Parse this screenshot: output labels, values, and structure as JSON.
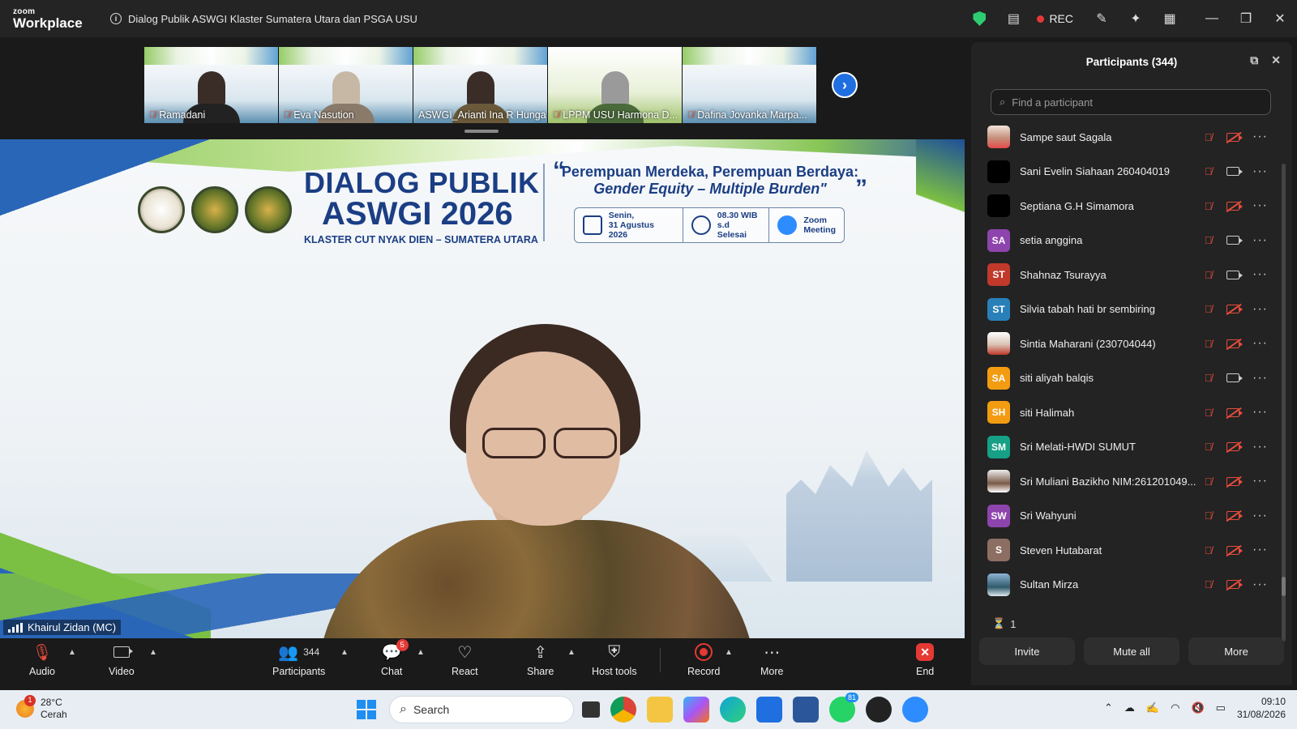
{
  "app": {
    "logo_small": "zoom",
    "logo_big": "Workplace",
    "meeting_title": "Dialog Publik ASWGI Klaster Sumatera Utara dan PSGA USU",
    "rec_label": "REC"
  },
  "strip": {
    "thumbnails": [
      {
        "name": "Ramadani"
      },
      {
        "name": "Eva Nasution"
      },
      {
        "name": "ASWGI_Arianti Ina R Hunga"
      },
      {
        "name": "LPPM USU Harmona D..."
      },
      {
        "name": "Dafina Jovanka Marpa..."
      }
    ]
  },
  "slide": {
    "title_line1": "DIALOG PUBLIK",
    "title_line2": "ASWGI 2026",
    "subtitle": "KLASTER CUT NYAK DIEN – SUMATERA UTARA",
    "quote_line1": "Perempuan Merdeka, Perempuan Berdaya:",
    "quote_line2": "Gender Equity – Multiple Burden\"",
    "quote_open": "“",
    "quote_close": "”",
    "date_line1": "Senin,",
    "date_line2": "31 Agustus 2026",
    "time_line1": "08.30 WIB",
    "time_line2": "s.d Selesai",
    "platform_line1": "Zoom",
    "platform_line2": "Meeting"
  },
  "speaker": {
    "name": "Khairul Zidan (MC)"
  },
  "participants_panel": {
    "title": "Participants (344)",
    "search_placeholder": "Find a participant",
    "items": [
      {
        "initials": "",
        "name": "Sampe saut Sagala",
        "video_on": false
      },
      {
        "initials": "",
        "name": "Sani Evelin Siahaan 260404019",
        "video_on": true
      },
      {
        "initials": "",
        "name": "Septiana G.H Simamora",
        "video_on": false
      },
      {
        "initials": "SA",
        "name": "setia anggina",
        "video_on": true,
        "color": "#8e44ad"
      },
      {
        "initials": "ST",
        "name": "Shahnaz Tsurayya",
        "video_on": true,
        "color": "#c0392b"
      },
      {
        "initials": "ST",
        "name": "Silvia tabah hati br sembiring",
        "video_on": false,
        "color": "#2980b9"
      },
      {
        "initials": "",
        "name": "Sintia Maharani (230704044)",
        "video_on": false
      },
      {
        "initials": "SA",
        "name": "siti aliyah balqis",
        "video_on": true,
        "color": "#f39c12"
      },
      {
        "initials": "SH",
        "name": "siti Halimah",
        "video_on": false,
        "color": "#f39c12"
      },
      {
        "initials": "SM",
        "name": "Sri Melati-HWDI SUMUT",
        "video_on": false,
        "color": "#16a085"
      },
      {
        "initials": "",
        "name": "Sri Muliani Bazikho NIM:261201049...",
        "video_on": false
      },
      {
        "initials": "SW",
        "name": "Sri Wahyuni",
        "video_on": false,
        "color": "#8e44ad"
      },
      {
        "initials": "S",
        "name": "Steven Hutabarat",
        "video_on": false,
        "color": "#8d6e63"
      },
      {
        "initials": "",
        "name": "Sultan Mirza",
        "video_on": false
      }
    ],
    "waiting_count": "1",
    "invite_label": "Invite",
    "mute_all_label": "Mute all",
    "more_label": "More"
  },
  "toolbar": {
    "audio": "Audio",
    "video": "Video",
    "participants": "Participants",
    "participants_count": "344",
    "chat": "Chat",
    "chat_badge": "5",
    "react": "React",
    "share": "Share",
    "host_tools": "Host tools",
    "record": "Record",
    "more": "More",
    "end": "End"
  },
  "taskbar": {
    "temperature": "28°C",
    "weather": "Cerah",
    "weather_badge": "1",
    "search": "Search",
    "whatsapp_badge": "81",
    "time": "09:10",
    "date": "31/08/2026"
  }
}
